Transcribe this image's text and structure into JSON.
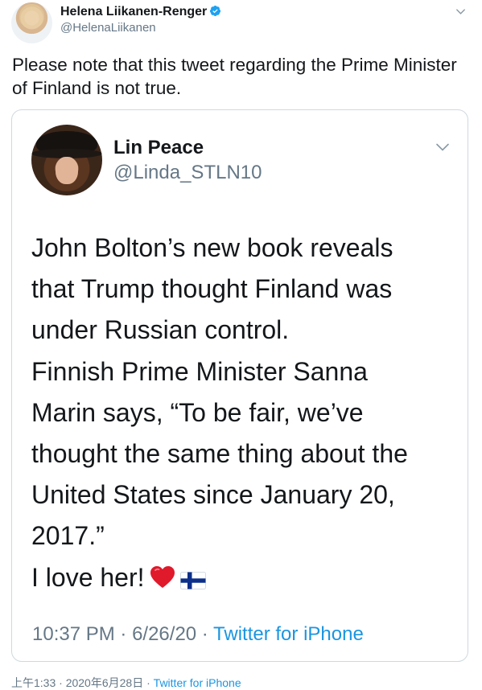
{
  "outer_tweet": {
    "author_name": "Helena Liikanen-Renger",
    "author_handle": "@HelenaLiikanen",
    "text": "Please note that this tweet regarding the Prime Minister of Finland is not true.",
    "footer": {
      "time": "上午1:33",
      "sep1": " · ",
      "date": "2020年6月28日",
      "sep2": " · ",
      "source": "Twitter for iPhone"
    }
  },
  "quoted_tweet": {
    "author_name": "Lin Peace",
    "author_handle": "@Linda_STLN10",
    "lines": [
      "John Bolton’s new book reveals",
      "that Trump thought Finland was",
      "under Russian control.",
      "Finnish Prime Minister Sanna",
      "Marin says, “To be fair, we’ve",
      "thought the same thing about the",
      "United States since January 20,",
      "2017.”",
      "I love her!"
    ],
    "emojis": [
      "red-heart",
      "finland-flag"
    ],
    "meta": {
      "time": "10:37 PM",
      "sep1": " · ",
      "date": "6/26/20",
      "sep2": " · ",
      "source": "Twitter for iPhone"
    }
  },
  "colors": {
    "text": "#14171a",
    "secondary": "#657786",
    "link": "#1b95e0",
    "verified": "#1da1f2",
    "border": "#cfd9de"
  }
}
